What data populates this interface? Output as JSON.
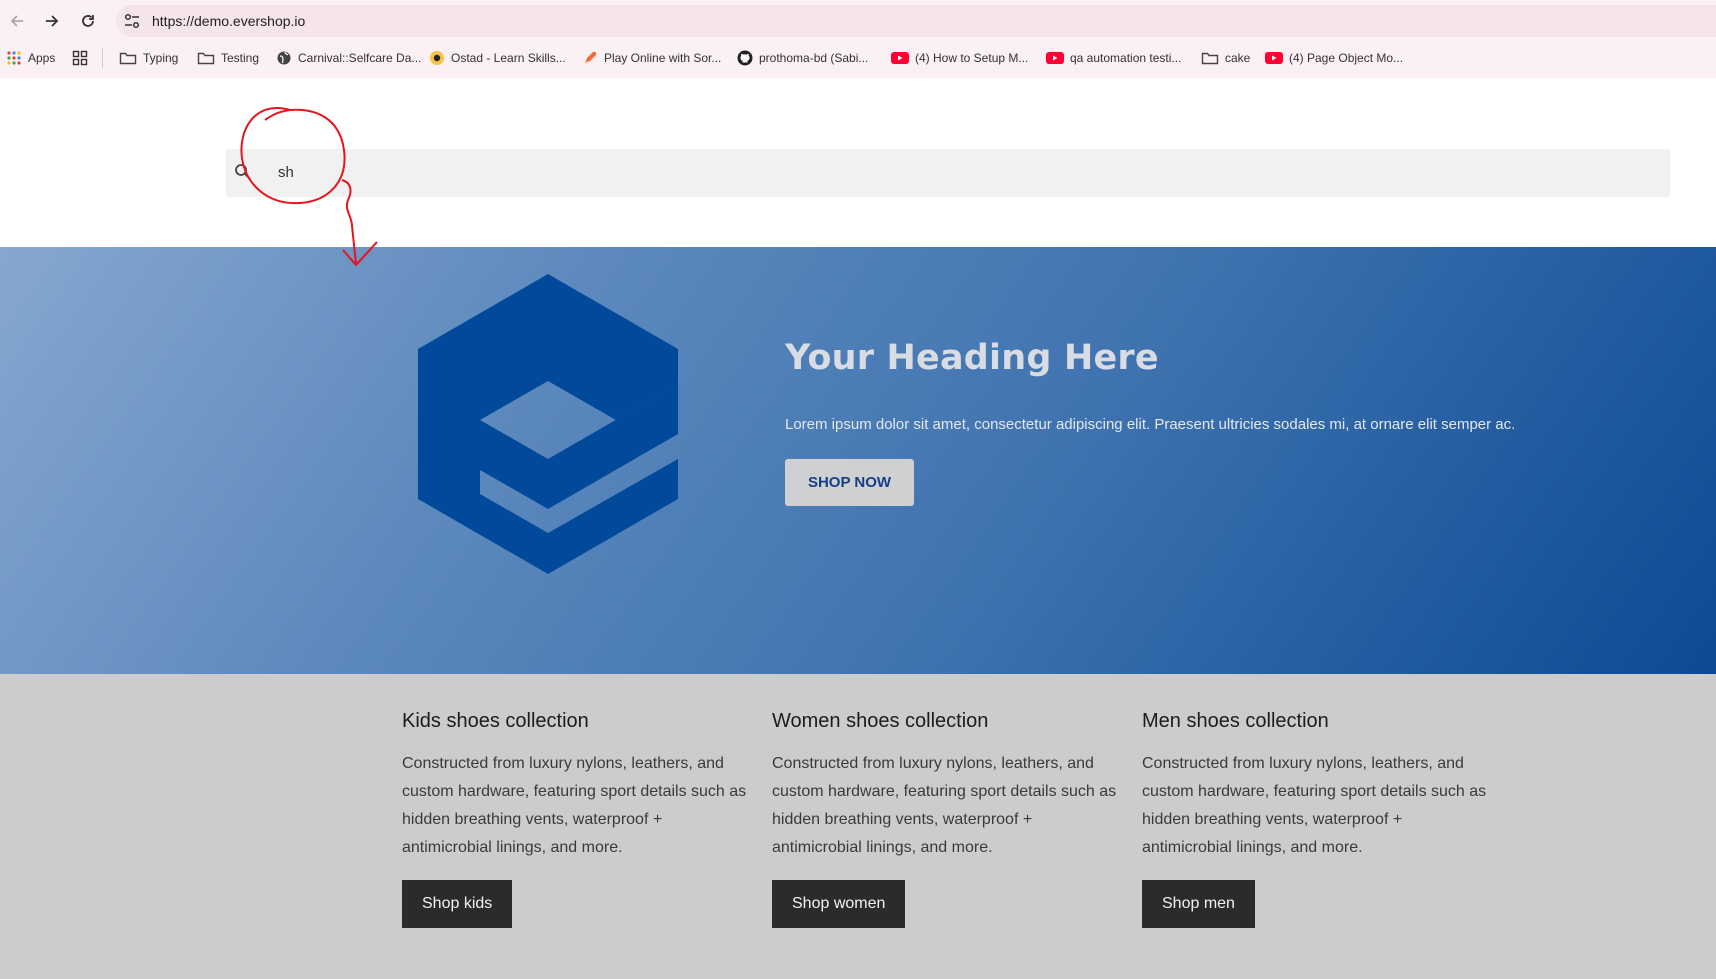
{
  "browser": {
    "url": "https://demo.evershop.io",
    "bookmarks": [
      {
        "label": "Apps",
        "icon": "apps-grid-icon"
      },
      {
        "label": "",
        "icon": "tab-groups-icon"
      },
      {
        "label": "Typing",
        "icon": "folder-icon"
      },
      {
        "label": "Testing",
        "icon": "folder-icon"
      },
      {
        "label": "Carnival::Selfcare Da...",
        "icon": "globe-icon"
      },
      {
        "label": "Ostad - Learn Skills...",
        "icon": "ostad-icon"
      },
      {
        "label": "Play Online with Sor...",
        "icon": "rocket-icon"
      },
      {
        "label": "prothoma-bd (Sabi...",
        "icon": "github-icon"
      },
      {
        "label": "(4) How to Setup M...",
        "icon": "youtube-icon"
      },
      {
        "label": "qa automation testi...",
        "icon": "youtube-icon"
      },
      {
        "label": "cake",
        "icon": "folder-icon"
      },
      {
        "label": "(4) Page Object Mo...",
        "icon": "youtube-icon"
      }
    ]
  },
  "search": {
    "value": "sh",
    "icon": "search-icon"
  },
  "hero": {
    "heading": "Your Heading Here",
    "text": "Lorem ipsum dolor sit amet, consectetur adipiscing elit. Praesent ultricies sodales mi, at ornare elit semper ac.",
    "button": "SHOP NOW",
    "logo_color": "#014a9b",
    "gradient": [
      "#86a7cf",
      "#0b4a93"
    ]
  },
  "collections": [
    {
      "title": "Kids shoes collection",
      "text": "Constructed from luxury nylons, leathers, and custom hardware, featuring sport details such as hidden breathing vents, waterproof + antimicrobial linings, and more.",
      "button": "Shop kids"
    },
    {
      "title": "Women shoes collection",
      "text": "Constructed from luxury nylons, leathers, and custom hardware, featuring sport details such as hidden breathing vents, waterproof + antimicrobial linings, and more.",
      "button": "Shop women"
    },
    {
      "title": "Men shoes collection",
      "text": "Constructed from luxury nylons, leathers, and custom hardware, featuring sport details such as hidden breathing vents, waterproof + antimicrobial linings, and more.",
      "button": "Shop men"
    }
  ],
  "annotation_color": "#e8141c"
}
